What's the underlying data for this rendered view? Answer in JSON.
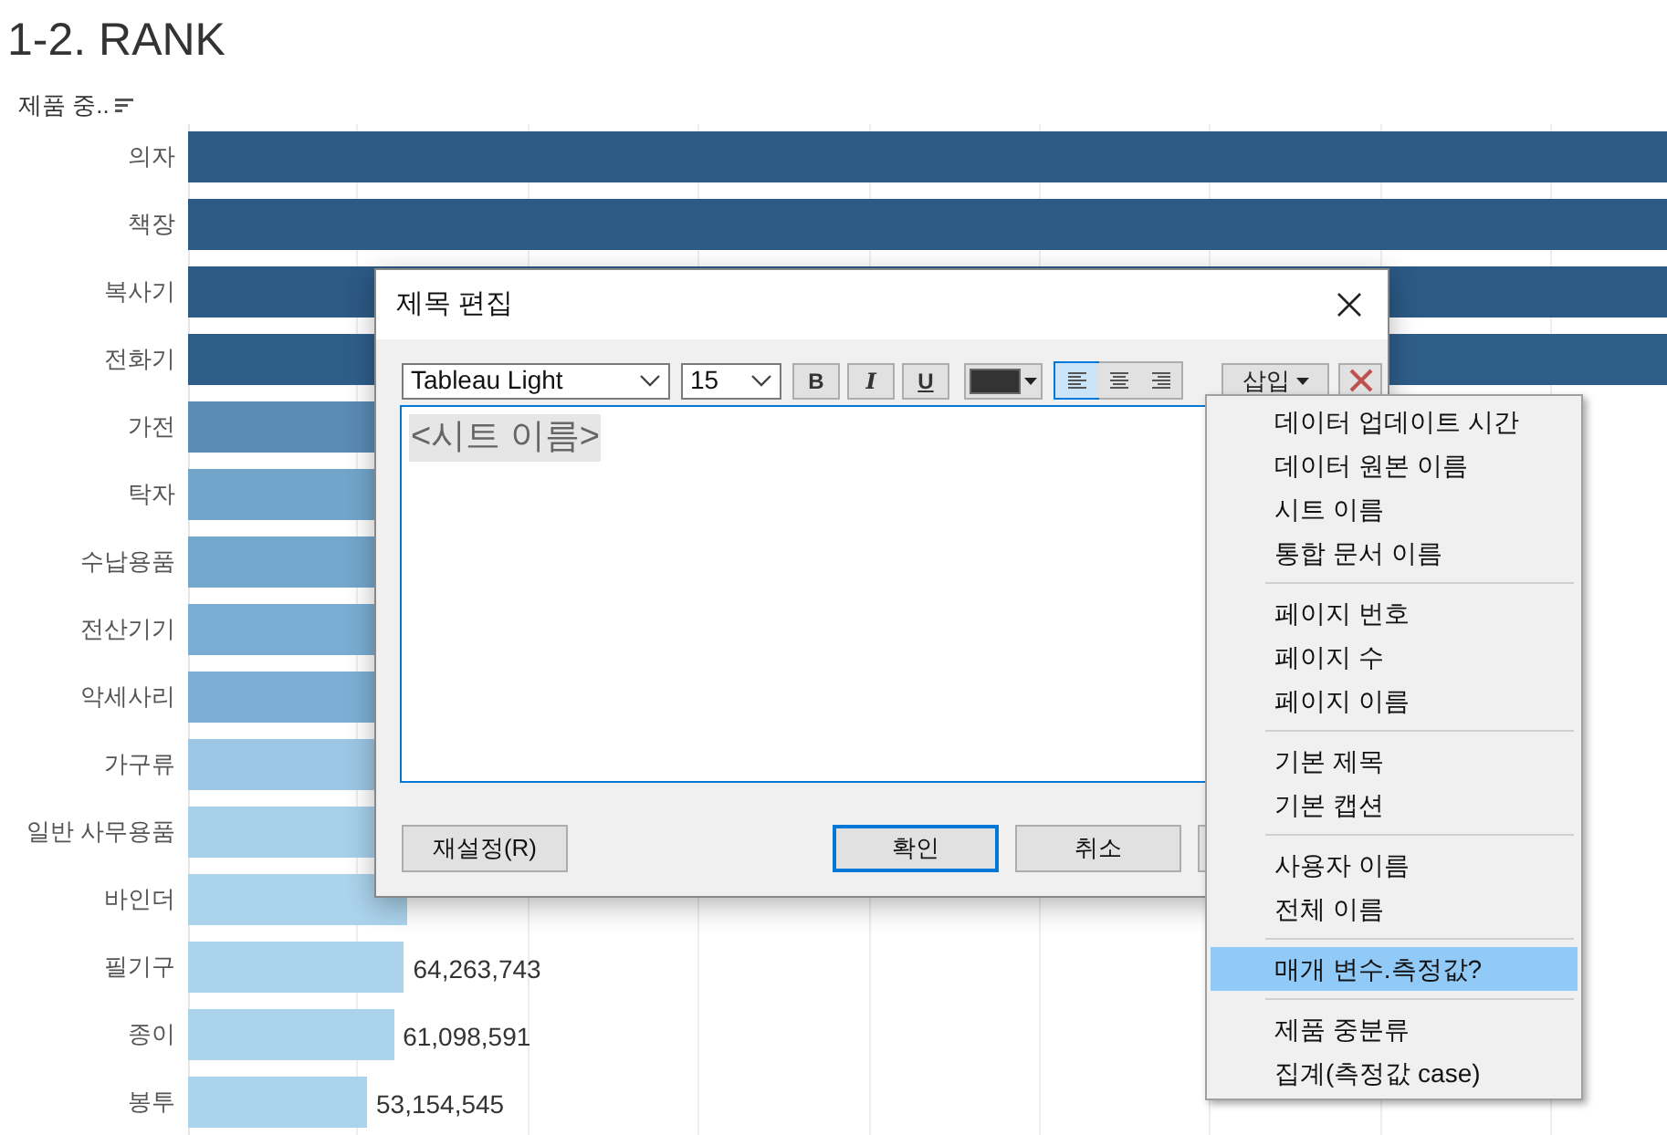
{
  "sheet_title": "1-2. RANK",
  "chart": {
    "header": "제품 중..",
    "rows": [
      {
        "label": "의자",
        "color": "#2c5985",
        "kind": "past_edge"
      },
      {
        "label": "책장",
        "color": "#2c5985",
        "kind": "past_edge"
      },
      {
        "label": "복사기",
        "color": "#2c5985",
        "kind": "past_edge"
      },
      {
        "label": "전화기",
        "color": "#2f5d8a",
        "kind": "past_edge"
      },
      {
        "label": "가전",
        "color": "#5a8ab5"
      },
      {
        "label": "탁자",
        "color": "#72a5ca"
      },
      {
        "label": "수납용품",
        "color": "#74a7cc"
      },
      {
        "label": "전산기기",
        "color": "#7aadd3"
      },
      {
        "label": "악세사리",
        "color": "#7dafd5"
      },
      {
        "label": "가구류",
        "color": "#9cc7e4"
      },
      {
        "label": "일반 사무용품",
        "color": "#a6cfea"
      },
      {
        "label": "바인더",
        "level": 0.148,
        "color": "#abd3ec"
      },
      {
        "label": "필기구",
        "level": 0.146,
        "color": "#abd3ec",
        "value": "64,263,743"
      },
      {
        "label": "종이",
        "level": 0.139,
        "color": "#abd3ec",
        "value": "61,098,591"
      },
      {
        "label": "봉투",
        "level": 0.121,
        "color": "#abd3ec",
        "value": "53,154,545"
      }
    ]
  },
  "dialog": {
    "title": "제목 편집",
    "font": "Tableau Light",
    "size": "15",
    "format_buttons": [
      {
        "label": "B",
        "kind": "bold"
      },
      {
        "label": "I",
        "kind": "italic"
      },
      {
        "label": "U",
        "kind": "underline"
      }
    ],
    "align_buttons": [
      {
        "kind": "left",
        "selected": true
      },
      {
        "kind": "center",
        "selected": false
      },
      {
        "kind": "right",
        "selected": false
      }
    ],
    "insert_button": "삽입",
    "text": "<시트 이름>",
    "buttons": [
      {
        "label": "재설정(R)",
        "kind": "reset"
      },
      {
        "label": "확인",
        "kind": "default"
      },
      {
        "label": "취소",
        "kind": "normal"
      },
      {
        "kind": "hidden"
      }
    ]
  },
  "insert_menu": {
    "groups": [
      [
        {
          "label": "데이터 업데이트 시간",
          "selected": false
        },
        {
          "label": "데이터 원본 이름",
          "selected": false
        },
        {
          "label": "시트 이름",
          "selected": false
        },
        {
          "label": "통합 문서 이름",
          "selected": false
        }
      ],
      [
        {
          "label": "페이지 번호",
          "selected": false
        },
        {
          "label": "페이지 수",
          "selected": false
        },
        {
          "label": "페이지 이름",
          "selected": false
        }
      ],
      [
        {
          "label": "기본 제목",
          "selected": false
        },
        {
          "label": "기본 캡션",
          "selected": false
        }
      ],
      [
        {
          "label": "사용자 이름",
          "selected": false
        },
        {
          "label": "전체 이름",
          "selected": false
        }
      ],
      [
        {
          "label": "매개 변수.측정값?",
          "selected": true
        }
      ],
      [
        {
          "label": "제품 중분류",
          "selected": false
        },
        {
          "label": "집계(측정값 case)",
          "selected": false
        }
      ]
    ]
  }
}
